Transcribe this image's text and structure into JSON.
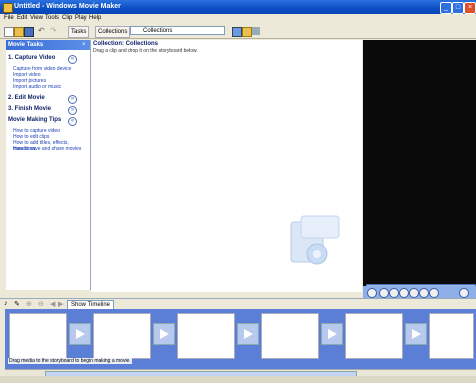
{
  "window": {
    "title": "Untitled - Windows Movie Maker"
  },
  "menu": [
    "File",
    "Edit",
    "View",
    "Tools",
    "Clip",
    "Play",
    "Help"
  ],
  "toolbar": {
    "tasks_label": "Tasks",
    "collections_label": "Collections",
    "collection_select": "Collections"
  },
  "task_pane": {
    "header": "Movie Tasks",
    "sections": [
      {
        "title": "1. Capture Video",
        "links": [
          "Capture from video device",
          "Import video",
          "Import pictures",
          "Import audio or music"
        ]
      },
      {
        "title": "2. Edit Movie",
        "links": []
      },
      {
        "title": "3. Finish Movie",
        "links": []
      },
      {
        "title": "Movie Making Tips",
        "links": [
          "How to capture video",
          "How to edit clips",
          "How to add titles, effects, transitions",
          "How to save and share movies"
        ]
      }
    ]
  },
  "collection": {
    "caption": "Collection: Collections",
    "subtitle": "Drag a clip and drop it on the storyboard below."
  },
  "storyboard": {
    "show_timeline_label": "Show Timeline",
    "hint": "Drag media to the storyboard to begin making a movie."
  },
  "colors": {
    "titlebar": "#0a4fc4",
    "storyboard": "#5b7fd6",
    "monitor": "#0a0a0a"
  }
}
